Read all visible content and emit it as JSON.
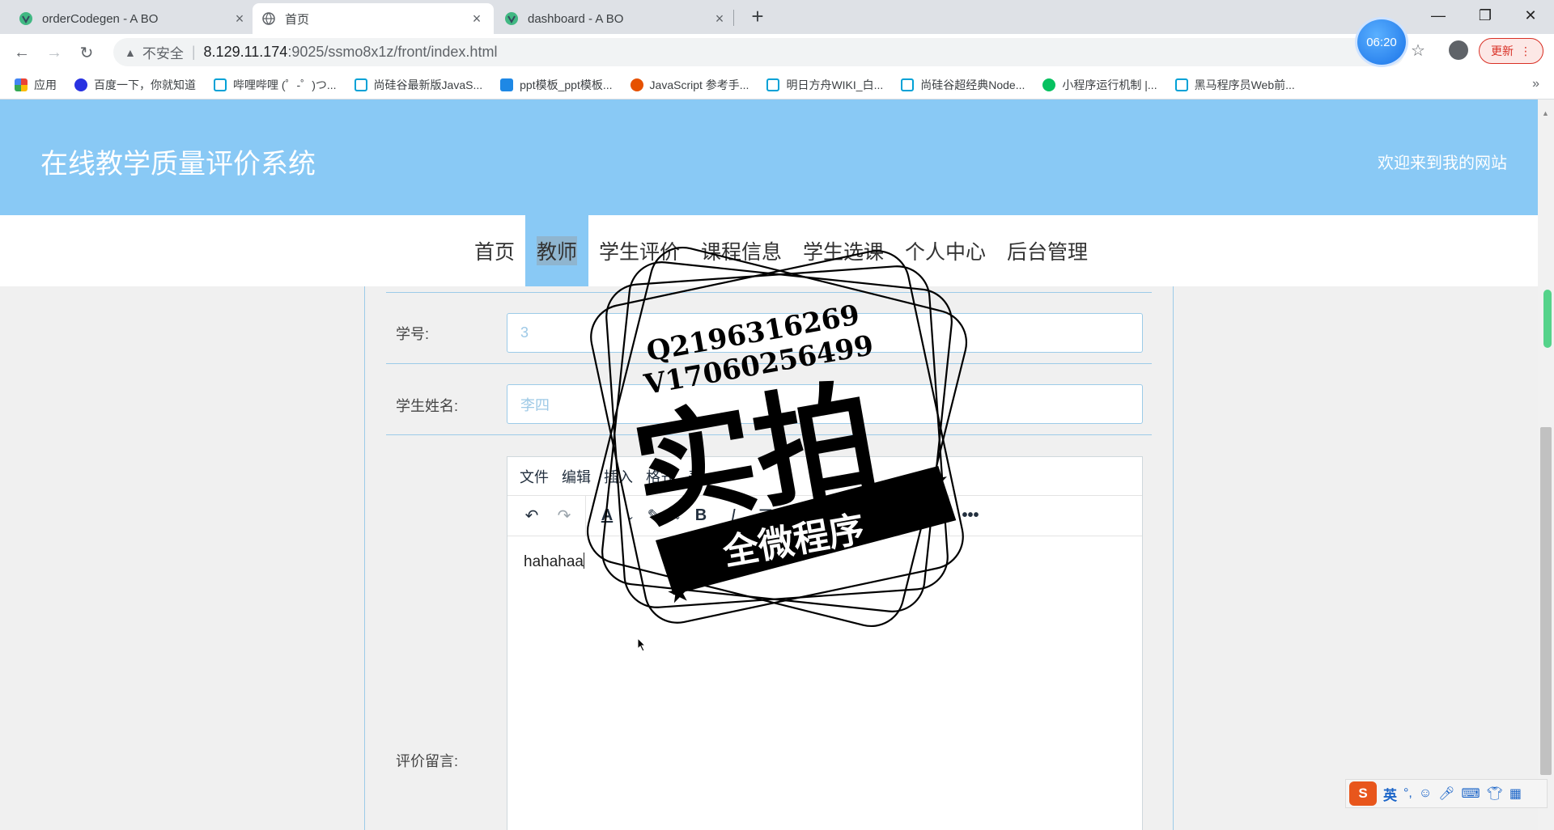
{
  "browser": {
    "tabs": [
      {
        "title": "orderCodegen - A BO",
        "icon": "vue-icon"
      },
      {
        "title": "首页",
        "icon": "globe-icon"
      },
      {
        "title": "dashboard - A BO",
        "icon": "vue-icon"
      }
    ],
    "new_tab": "+",
    "url_warning": "不安全",
    "url_host": "8.129.11.174",
    "url_path": ":9025/ssmo8x1z/front/index.html",
    "clock": "06:20",
    "update_label": "更新",
    "bookmarks": [
      {
        "label": "应用",
        "color": "#4285f4"
      },
      {
        "label": "百度一下，你就知道",
        "color": "#2932e1"
      },
      {
        "label": "哔哩哔哩 (゜-゜)つ...",
        "color": "#00a1d6"
      },
      {
        "label": "尚硅谷最新版JavaS...",
        "color": "#00a1d6"
      },
      {
        "label": "ppt模板_ppt模板...",
        "color": "#1e88e5"
      },
      {
        "label": "JavaScript 参考手...",
        "color": "#e65100"
      },
      {
        "label": "明日方舟WIKI_白...",
        "color": "#00a1d6"
      },
      {
        "label": "尚硅谷超经典Node...",
        "color": "#00a1d6"
      },
      {
        "label": "小程序运行机制 |...",
        "color": "#07c160"
      },
      {
        "label": "黑马程序员Web前...",
        "color": "#00a1d6"
      }
    ],
    "bookmarks_more": "»"
  },
  "site": {
    "title": "在线教学质量评价系统",
    "welcome": "欢迎来到我的网站",
    "nav": [
      "首页",
      "教师",
      "学生评价",
      "课程信息",
      "学生选课",
      "个人中心",
      "后台管理"
    ],
    "active_nav": "教师",
    "header_color": "#89c9f5"
  },
  "form": {
    "student_id_label": "学号:",
    "student_id_value": "3",
    "student_name_label": "学生姓名:",
    "student_name_value": "李四",
    "comment_label": "评价留言:",
    "editor_menu": [
      "文件",
      "编辑",
      "插入",
      "格式",
      "表"
    ],
    "editor_content": "hahahaa"
  },
  "watermark": {
    "line1": "Q2196316269",
    "line2": "V17060256499",
    "big": "实拍",
    "ribbon": "全微程序"
  },
  "ime": {
    "logo": "S",
    "mode": "英"
  }
}
